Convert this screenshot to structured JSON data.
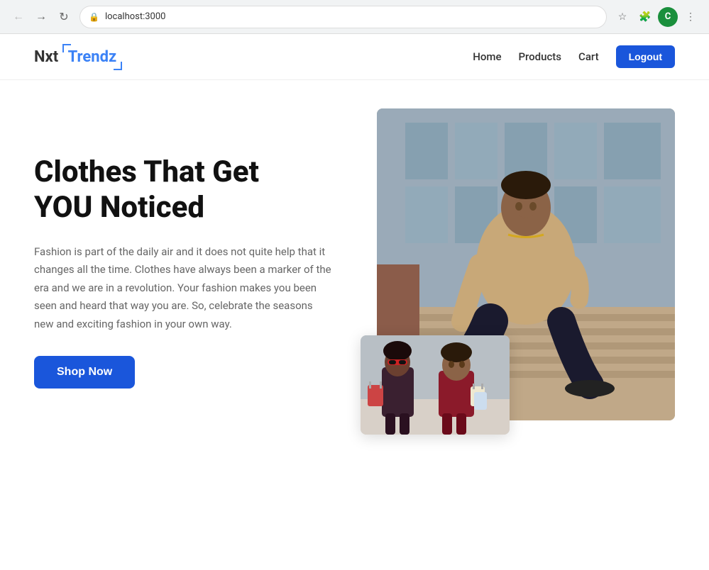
{
  "browser": {
    "url": "localhost:3000",
    "back_label": "←",
    "forward_label": "→",
    "refresh_label": "↻",
    "lock_icon": "🔒",
    "star_icon": "☆",
    "extensions_icon": "🧩",
    "menu_icon": "⋮",
    "user_initial": "C"
  },
  "navbar": {
    "logo_nxt": "Nxt",
    "logo_trendz": "Trendz",
    "nav_home": "Home",
    "nav_products": "Products",
    "nav_cart": "Cart",
    "logout_label": "Logout"
  },
  "hero": {
    "title_line1": "Clothes That Get",
    "title_line2": "YOU Noticed",
    "description": "Fashion is part of the daily air and it does not quite help that it changes all the time. Clothes have always been a marker of the era and we are in a revolution. Your fashion makes you been seen and heard that way you are. So, celebrate the seasons new and exciting fashion in your own way.",
    "shop_now_label": "Shop Now"
  },
  "colors": {
    "primary_blue": "#1a56db",
    "logo_blue": "#3b82f6",
    "text_dark": "#111111",
    "text_gray": "#666666",
    "brown_accent": "#8b5c4a"
  }
}
